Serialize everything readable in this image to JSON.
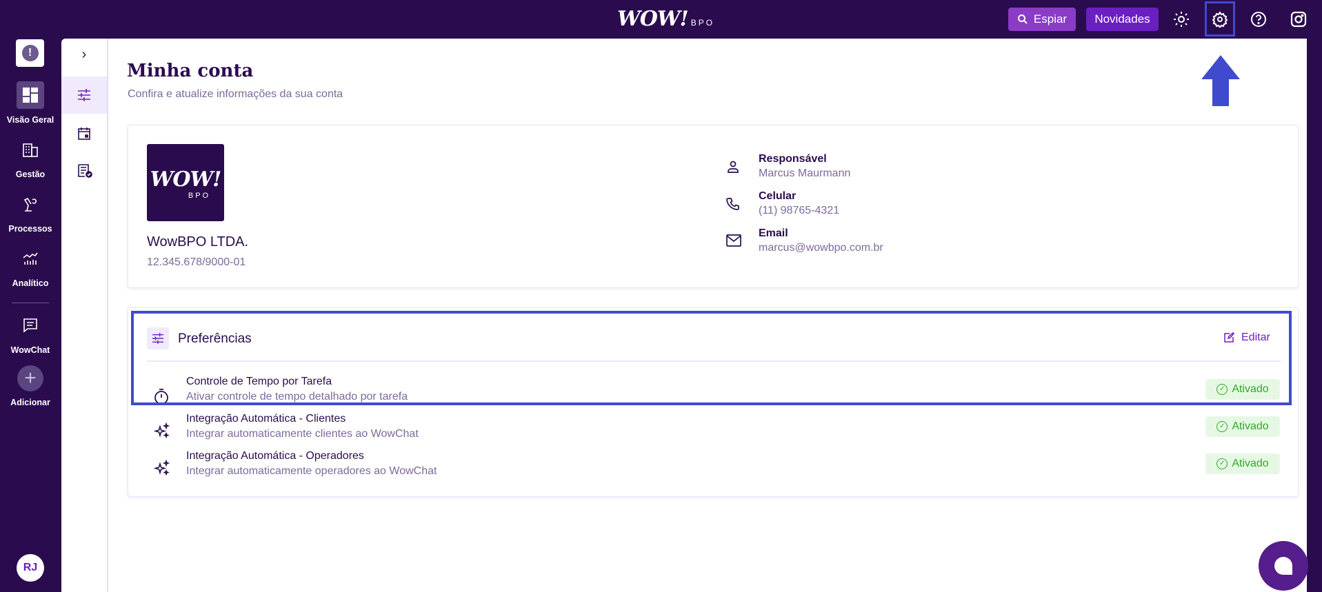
{
  "topbar": {
    "logo": "WOW!",
    "logo_sub": "BPO",
    "espiar": "Espiar",
    "novidades": "Novidades"
  },
  "rail": {
    "items": [
      {
        "label": "Visão Geral"
      },
      {
        "label": "Gestão"
      },
      {
        "label": "Processos"
      },
      {
        "label": "Analítico"
      },
      {
        "label": "WowChat"
      },
      {
        "label": "Adicionar"
      }
    ],
    "avatar": "RJ"
  },
  "page": {
    "title": "Minha conta",
    "subtitle": "Confira e atualize informações da sua conta"
  },
  "company": {
    "logo": "WOW!",
    "logo_sub": "BPO",
    "name": "WowBPO LTDA.",
    "cnpj": "12.345.678/9000-01"
  },
  "contacts": [
    {
      "label": "Responsável",
      "value": "Marcus Maurmann"
    },
    {
      "label": "Celular",
      "value": "(11) 98765-4321"
    },
    {
      "label": "Email",
      "value": "marcus@wowbpo.com.br"
    }
  ],
  "preferences": {
    "title": "Preferências",
    "edit": "Editar",
    "items": [
      {
        "title": "Controle de Tempo por Tarefa",
        "desc": "Ativar controle de tempo detalhado por tarefa",
        "status": "Ativado"
      },
      {
        "title": "Integração Automática - Clientes",
        "desc": "Integrar automaticamente clientes ao WowChat",
        "status": "Ativado"
      },
      {
        "title": "Integração Automática - Operadores",
        "desc": "Integrar automaticamente operadores ao WowChat",
        "status": "Ativado"
      }
    ]
  },
  "colors": {
    "bg": "#2a0c4e",
    "accent": "#6a1fc0",
    "highlight": "#3f4bcc",
    "success": "#2faa25"
  }
}
